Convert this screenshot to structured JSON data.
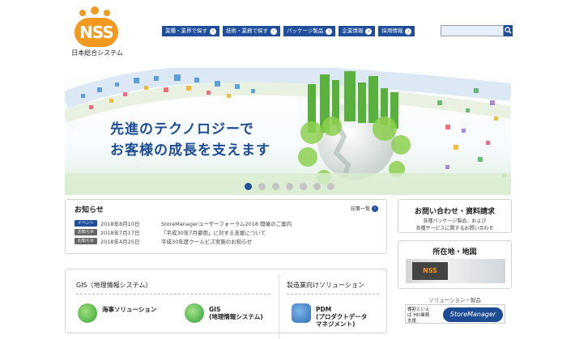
{
  "header": {
    "logo_text": "NSS",
    "company_name": "日本総合システム",
    "nav": [
      {
        "label": "業種・業界で探す"
      },
      {
        "label": "技術・業務で探す"
      },
      {
        "label": "パッケージ製品"
      },
      {
        "label": "企業情報"
      },
      {
        "label": "採用情報"
      }
    ],
    "search_value": ""
  },
  "hero": {
    "line1": "先進のテクノロジーで",
    "line2": "お客様の成長を支えます",
    "slide_count": 7,
    "active_slide": 1
  },
  "news": {
    "title": "お知らせ",
    "more_label": "記事一覧",
    "items": [
      {
        "badge": "イベント",
        "date": "2018年8月10日",
        "text": "StoreManagerユーザーフォーラム2018 開催のご案内"
      },
      {
        "badge": "お知らせ",
        "date": "2018年7月17日",
        "text": "「平成30年7月豪雨」に対する支援について"
      },
      {
        "badge": "お知らせ",
        "date": "2018年4月25日",
        "text": "平成30年度クールビズ実施のお知らせ"
      }
    ]
  },
  "contact": {
    "title": "お問い合わせ・資料請求",
    "sub1": "各種パッケージ製品、および",
    "sub2": "各種サービスに関するお問い合わせ"
  },
  "location": {
    "title": "所在地・地図",
    "sign": "NSS"
  },
  "solutions": {
    "label": "ソリューション・製品",
    "banner_left": "棚割といえば MD業務支援",
    "banner_right": "StoreManager"
  },
  "bottom": {
    "gis_title": "GIS（地理情報システム）",
    "gis_items": [
      {
        "label1": "海事ソリューション",
        "label2": ""
      },
      {
        "label1": "GIS",
        "label2": "(地理情報システム)"
      }
    ],
    "mfg_title": "製造業向けソリューション",
    "mfg_items": [
      {
        "label1": "PDM",
        "label2": "(プロダクトデータ",
        "label3": "マネジメント)"
      }
    ]
  },
  "colors": {
    "brand_orange": "#f29a1f",
    "brand_blue": "#1f4e9a",
    "hero_text": "#1d4c95"
  }
}
